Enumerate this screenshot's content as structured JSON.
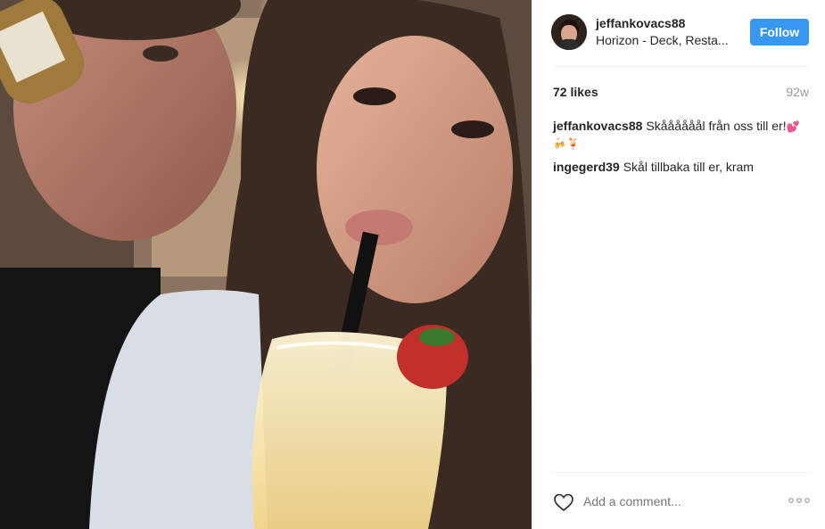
{
  "post": {
    "username": "jeffankovacs88",
    "location": "Horizon - Deck, Resta...",
    "follow_label": "Follow",
    "likes": "72 likes",
    "age": "92w"
  },
  "comments": [
    {
      "user": "jeffankovacs88",
      "text": "Skåååååål från oss till er!",
      "emoji": "💕🍻🍹"
    },
    {
      "user": "ingegerd39",
      "text": "Skål tillbaka till er, kram",
      "emoji": ""
    }
  ],
  "composer": {
    "placeholder": "Add a comment..."
  },
  "icons": {
    "like": "heart-outline-icon",
    "more": "more-options-icon"
  },
  "colors": {
    "follow_button": "#3897f0",
    "muted_text": "#999999"
  }
}
